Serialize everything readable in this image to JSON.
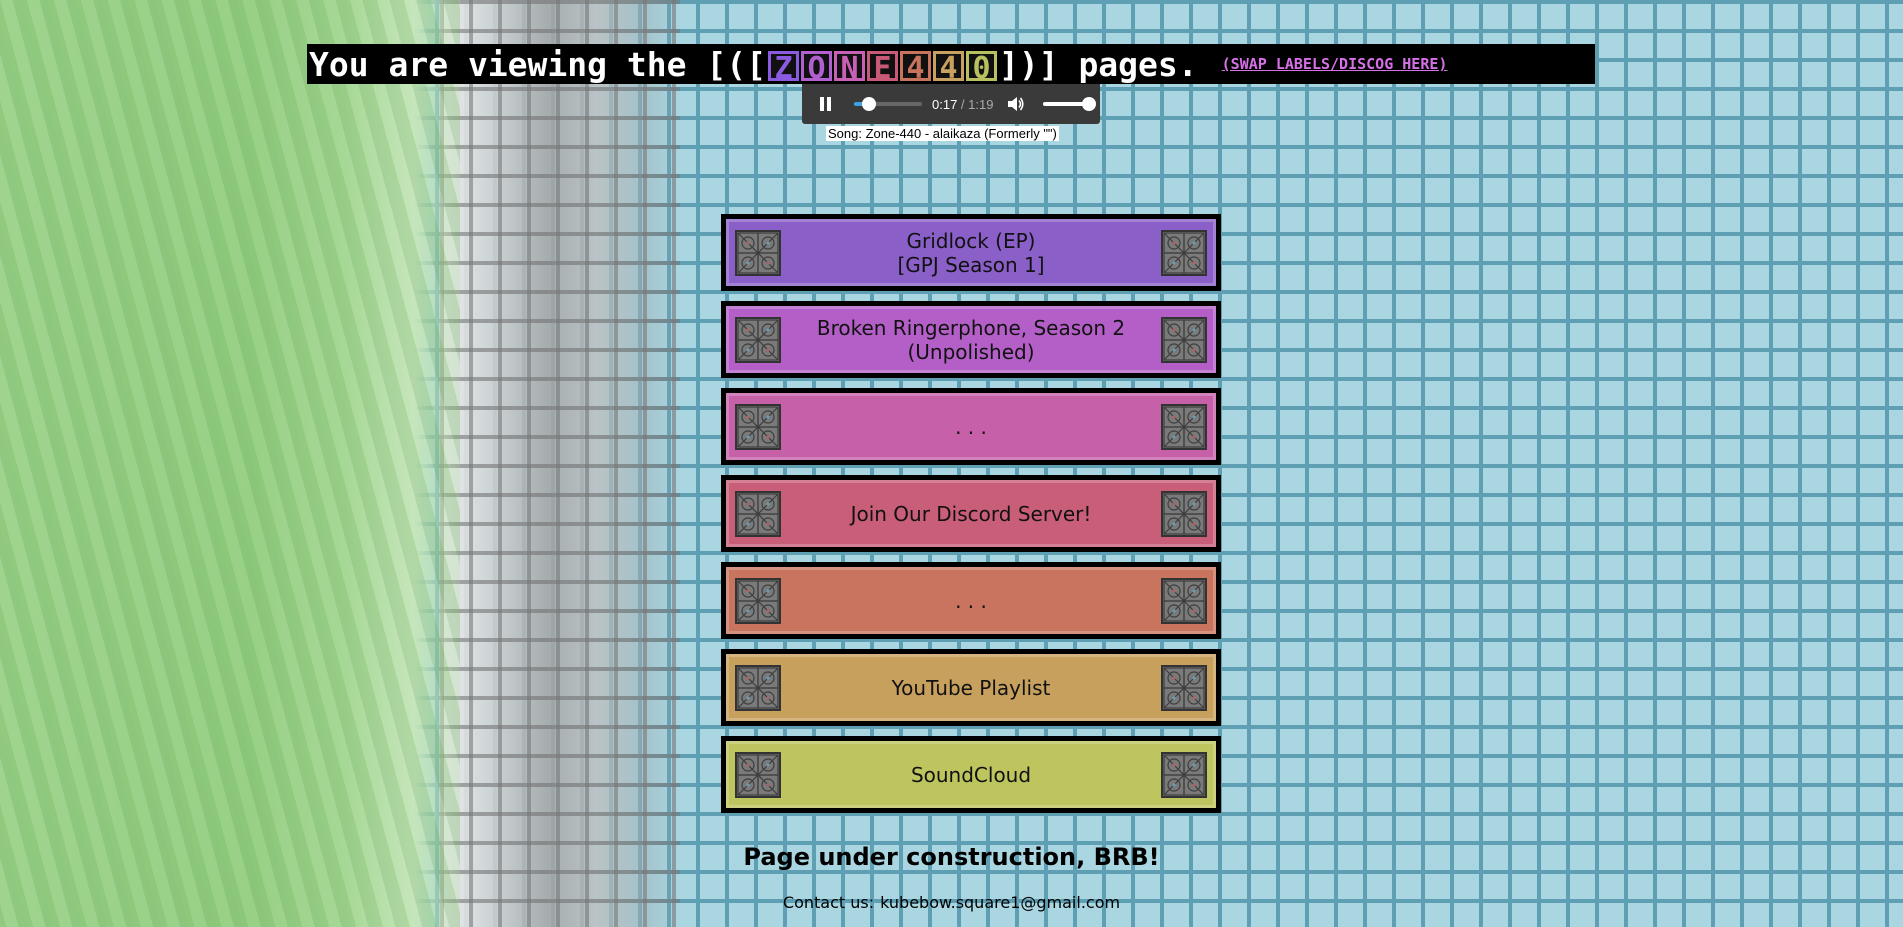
{
  "header": {
    "prefix": "You are viewing the [([",
    "logo_letters": [
      "Z",
      "O",
      "N",
      "E",
      "4",
      "4",
      "0"
    ],
    "logo_colors": [
      "#8a5ae0",
      "#b25fd0",
      "#c860b8",
      "#c85a78",
      "#c8745c",
      "#c8a060",
      "#b8c060"
    ],
    "suffix": "])] pages.",
    "swap_link": "(SWAP LABELS/DISCOG HERE)"
  },
  "player": {
    "current_time": "0:17",
    "separator": " / ",
    "duration": "1:19",
    "progress": 0.215,
    "volume": 1.0
  },
  "song_caption": "Song: Zone-440 - alaikaza (Formerly \"\")",
  "nav_buttons": [
    {
      "label": "Gridlock (EP)\n[GPJ Season 1]",
      "color": "#8a5fc8"
    },
    {
      "label": "Broken Ringerphone, Season 2\n(Unpolished)",
      "color": "#b45fc8"
    },
    {
      "label": ". . .",
      "color": "#c660a8"
    },
    {
      "label": "Join Our Discord Server!",
      "color": "#c85e78"
    },
    {
      "label": ". . .",
      "color": "#c8745e"
    },
    {
      "label": "YouTube Playlist",
      "color": "#c8a05e"
    },
    {
      "label": "SoundCloud",
      "color": "#bec45e"
    }
  ],
  "footer": {
    "construction": "Page under construction, BRB!",
    "contact_label": "Contact us:",
    "contact_email": "kubebow.square1@gmail.com"
  }
}
